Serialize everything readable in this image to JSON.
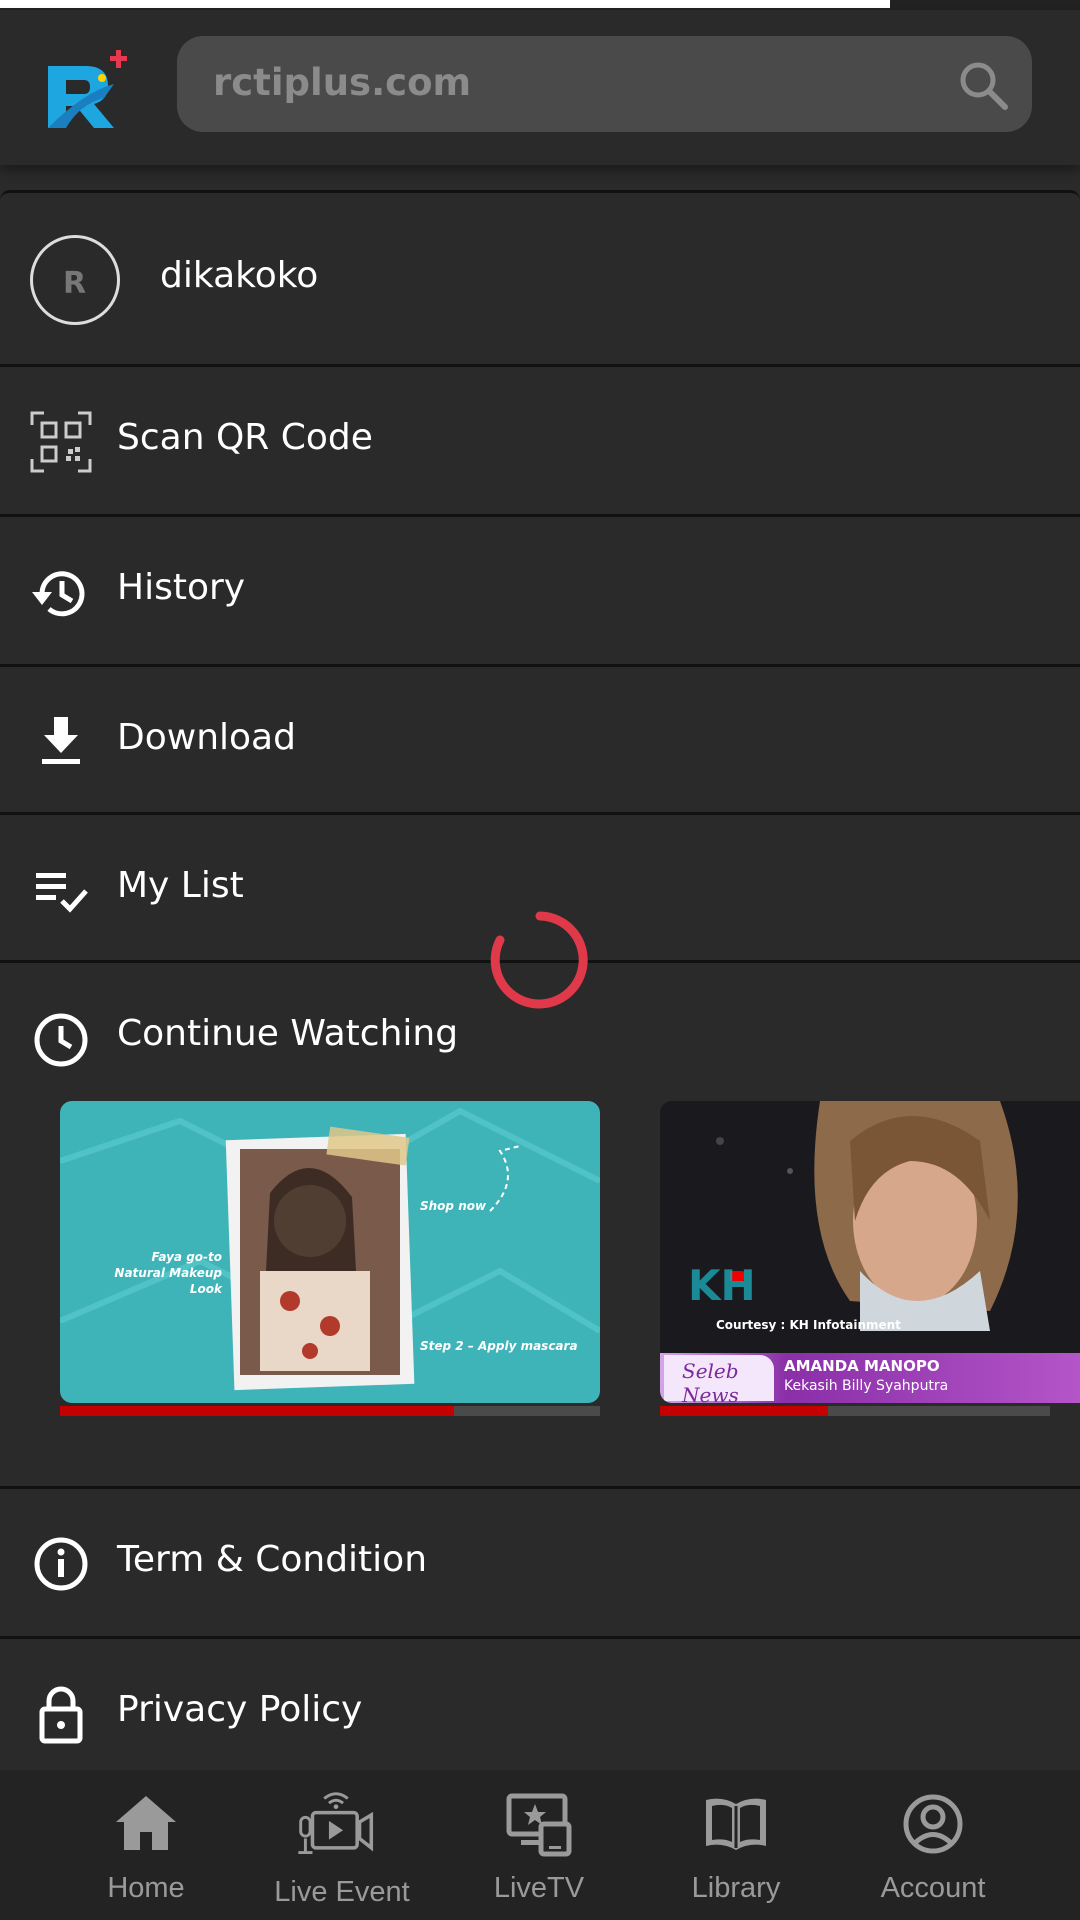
{
  "header": {
    "search_text": "rctiplus.com"
  },
  "profile": {
    "username": "dikakoko"
  },
  "menu": {
    "items": [
      {
        "label": "Scan QR Code",
        "icon": "qr-code-icon"
      },
      {
        "label": "History",
        "icon": "history-icon"
      },
      {
        "label": "Download",
        "icon": "download-icon"
      },
      {
        "label": "My List",
        "icon": "playlist-check-icon"
      },
      {
        "label": "Continue Watching",
        "icon": "clock-icon"
      },
      {
        "label": "Term & Condition",
        "icon": "info-icon"
      },
      {
        "label": "Privacy Policy",
        "icon": "lock-icon"
      }
    ]
  },
  "continue_watching": {
    "items": [
      {
        "title_line1": "Faya go-to",
        "title_line2": "Natural Makeup Look",
        "tag1": "Shop now",
        "tag2": "Step 2 – Apply mascara",
        "progress": 0.73
      },
      {
        "courtesy": "Courtesy : KH Infotainment",
        "brand": "Seleb News",
        "name": "AMANDA MANOPO",
        "caption": "Kekasih Billy Syahputra",
        "progress": 0.43
      }
    ]
  },
  "colors": {
    "accent": "#c40000",
    "background": "#2a2a2a",
    "spinner": "#e03a4a"
  },
  "bottom_nav": {
    "items": [
      {
        "label": "Home",
        "icon": "home-icon"
      },
      {
        "label": "Live Event",
        "icon": "live-event-icon"
      },
      {
        "label": "LiveTV",
        "icon": "live-tv-icon"
      },
      {
        "label": "Library",
        "icon": "library-icon"
      },
      {
        "label": "Account",
        "icon": "account-icon"
      }
    ]
  }
}
